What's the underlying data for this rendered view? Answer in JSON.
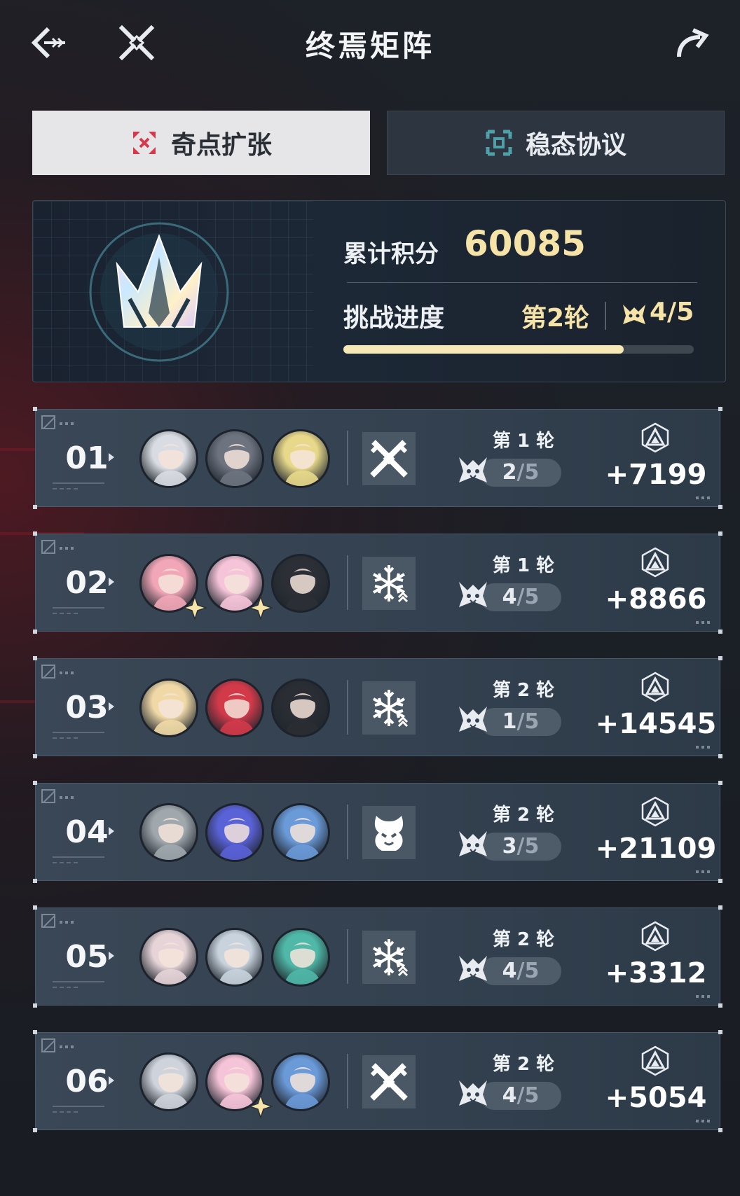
{
  "header": {
    "title": "终焉矩阵",
    "back_icon": "back-arrow-icon",
    "close_icon": "crossed-swords-icon",
    "share_icon": "share-arrow-icon"
  },
  "tabs": [
    {
      "label": "奇点扩张",
      "icon": "singularity-icon",
      "active": true
    },
    {
      "label": "稳态协议",
      "icon": "steady-protocol-icon",
      "active": false
    }
  ],
  "summary": {
    "score_label": "累计积分",
    "score_value": "60085",
    "progress_label": "挑战进度",
    "round_label": "第2轮",
    "boss_count": "4/5",
    "progress_fraction": 0.8
  },
  "teams": [
    {
      "index": "01",
      "element": "physical",
      "round": "第 1 轮",
      "kills": "2",
      "total": "/5",
      "points": "+7199",
      "avatar_colors": [
        "#d9dde3",
        "#6d7480",
        "#e8d98a"
      ],
      "badges": [
        false,
        false,
        false
      ]
    },
    {
      "index": "02",
      "element": "ice",
      "round": "第 1 轮",
      "kills": "4",
      "total": "/5",
      "points": "+8866",
      "avatar_colors": [
        "#f2a7b8",
        "#f6c4d8",
        "#2c2f36"
      ],
      "badges": [
        true,
        true,
        false
      ]
    },
    {
      "index": "03",
      "element": "ice",
      "round": "第 2 轮",
      "kills": "1",
      "total": "/5",
      "points": "+14545",
      "avatar_colors": [
        "#f0d9a6",
        "#d23a4a",
        "#2a2d33"
      ],
      "badges": [
        false,
        false,
        false
      ]
    },
    {
      "index": "04",
      "element": "imaginary",
      "round": "第 2 轮",
      "kills": "3",
      "total": "/5",
      "points": "+21109",
      "avatar_colors": [
        "#a0a8ae",
        "#5a62d8",
        "#6a9ad8"
      ],
      "badges": [
        false,
        false,
        false
      ]
    },
    {
      "index": "05",
      "element": "ice",
      "round": "第 2 轮",
      "kills": "4",
      "total": "/5",
      "points": "+3312",
      "avatar_colors": [
        "#e6d4d8",
        "#c8d3de",
        "#4fb8a8"
      ],
      "badges": [
        false,
        false,
        false
      ]
    },
    {
      "index": "06",
      "element": "physical",
      "round": "第 2 轮",
      "kills": "4",
      "total": "/5",
      "points": "+5054",
      "avatar_colors": [
        "#cfd4dc",
        "#f6c4d8",
        "#6a9ad8"
      ],
      "badges": [
        false,
        true,
        false
      ]
    }
  ],
  "colors": {
    "accent_gold": "#f5e3a8",
    "tab_active_bg": "#e6e6e8",
    "row_bg": "#3a4756",
    "progress_fill": "#f7e9b6"
  }
}
